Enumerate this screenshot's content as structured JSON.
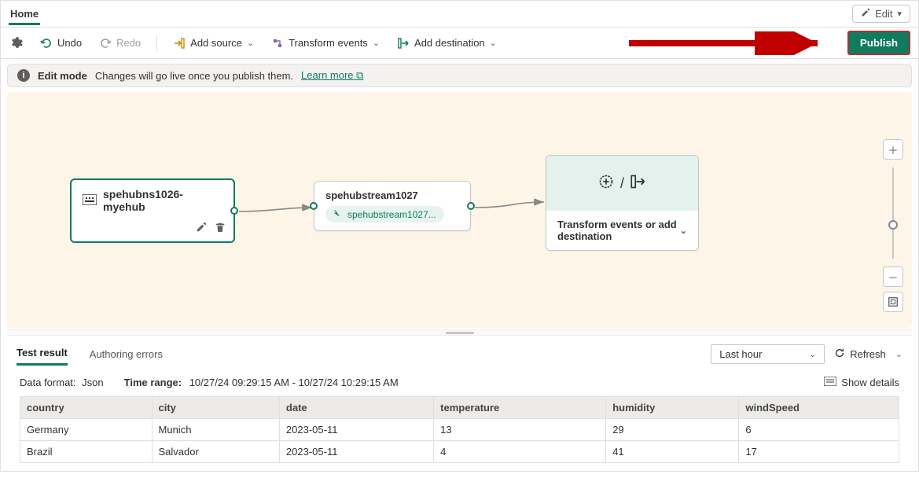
{
  "header": {
    "home": "Home",
    "edit_label": "Edit"
  },
  "toolbar": {
    "undo": "Undo",
    "redo": "Redo",
    "add_source": "Add source",
    "transform": "Transform events",
    "add_dest": "Add destination",
    "publish": "Publish"
  },
  "editbar": {
    "title": "Edit mode",
    "msg": "Changes will go live once you publish them.",
    "learn": "Learn more"
  },
  "nodes": {
    "n1_title": "spehubns1026-myehub",
    "n2_title": "spehubstream1027",
    "n2_pill": "spehubstream1027...",
    "n3_text": "Transform events or add destination"
  },
  "tabs": {
    "test_result": "Test result",
    "auth_errors": "Authoring errors",
    "timerange_dd": "Last hour",
    "refresh": "Refresh"
  },
  "meta": {
    "dataformat_label": "Data format:",
    "dataformat_value": "Json",
    "timerange_label": "Time range:",
    "timerange_value": "10/27/24 09:29:15 AM - 10/27/24 10:29:15 AM",
    "show_details": "Show details"
  },
  "table": {
    "headers": [
      "country",
      "city",
      "date",
      "temperature",
      "humidity",
      "windSpeed"
    ],
    "rows": [
      [
        "Germany",
        "Munich",
        "2023-05-11",
        "13",
        "29",
        "6"
      ],
      [
        "Brazil",
        "Salvador",
        "2023-05-11",
        "4",
        "41",
        "17"
      ]
    ]
  }
}
